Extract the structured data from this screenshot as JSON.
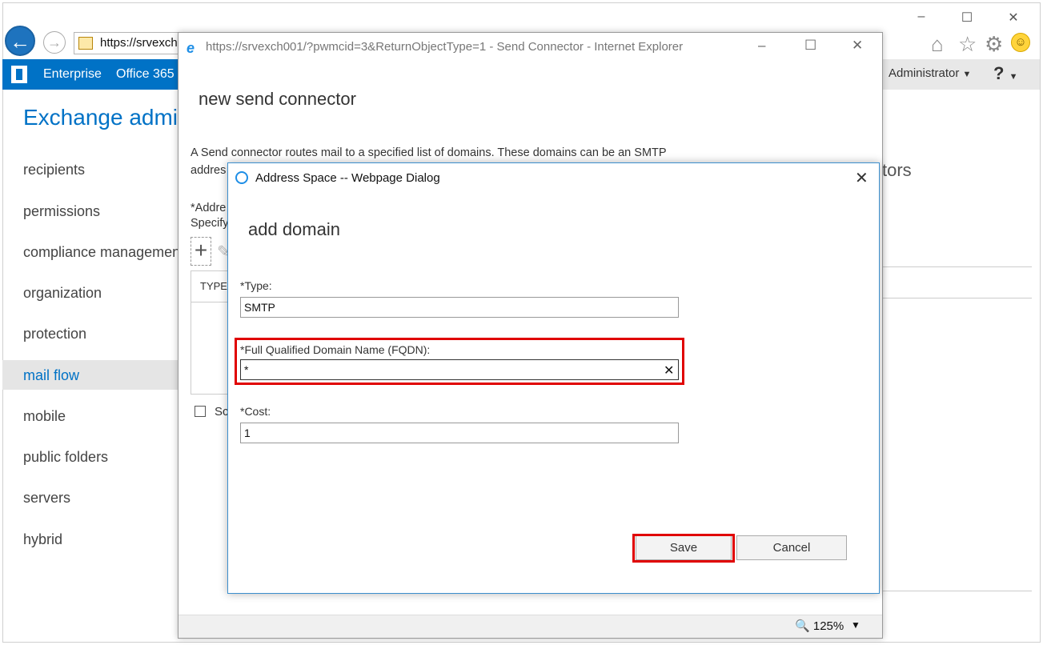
{
  "browser": {
    "address": "https://srvexch",
    "window_controls": {
      "minimize": "–",
      "maximize": "☐",
      "close": "✕"
    }
  },
  "eac": {
    "nav_links": [
      "Enterprise",
      "Office 365"
    ],
    "user_menu": "Administrator",
    "help_menu": "?",
    "title": "Exchange admin",
    "left_nav": [
      "recipients",
      "permissions",
      "compliance management",
      "organization",
      "protection",
      "mail flow",
      "mobile",
      "public folders",
      "servers",
      "hybrid"
    ],
    "selected_nav": "mail flow",
    "bg_partial_text": "tors"
  },
  "send_connector_window": {
    "title": "https://srvexch001/?pwmcid=3&ReturnObjectType=1 - Send Connector - Internet Explorer",
    "heading": "new send connector",
    "description_line1": "A Send connector routes mail to a specified list of domains. These domains can be an SMTP",
    "description_line2": "addres",
    "address_space_label": "*Addre",
    "specify_label": "Specify",
    "add_button": "+",
    "table_header_type": "TYPE",
    "checkbox_label": "Sc",
    "zoom": "125%"
  },
  "dialog": {
    "title": "Address Space -- Webpage Dialog",
    "heading": "add domain",
    "type_label": "*Type:",
    "type_value": "SMTP",
    "fqdn_label": "*Full Qualified Domain Name (FQDN):",
    "fqdn_value": "*",
    "fqdn_clear": "✕",
    "cost_label": "*Cost:",
    "cost_value": "1",
    "save_label": "Save",
    "cancel_label": "Cancel",
    "close": "✕"
  },
  "colors": {
    "accent_blue": "#0072c6",
    "highlight_red": "#e00000"
  }
}
